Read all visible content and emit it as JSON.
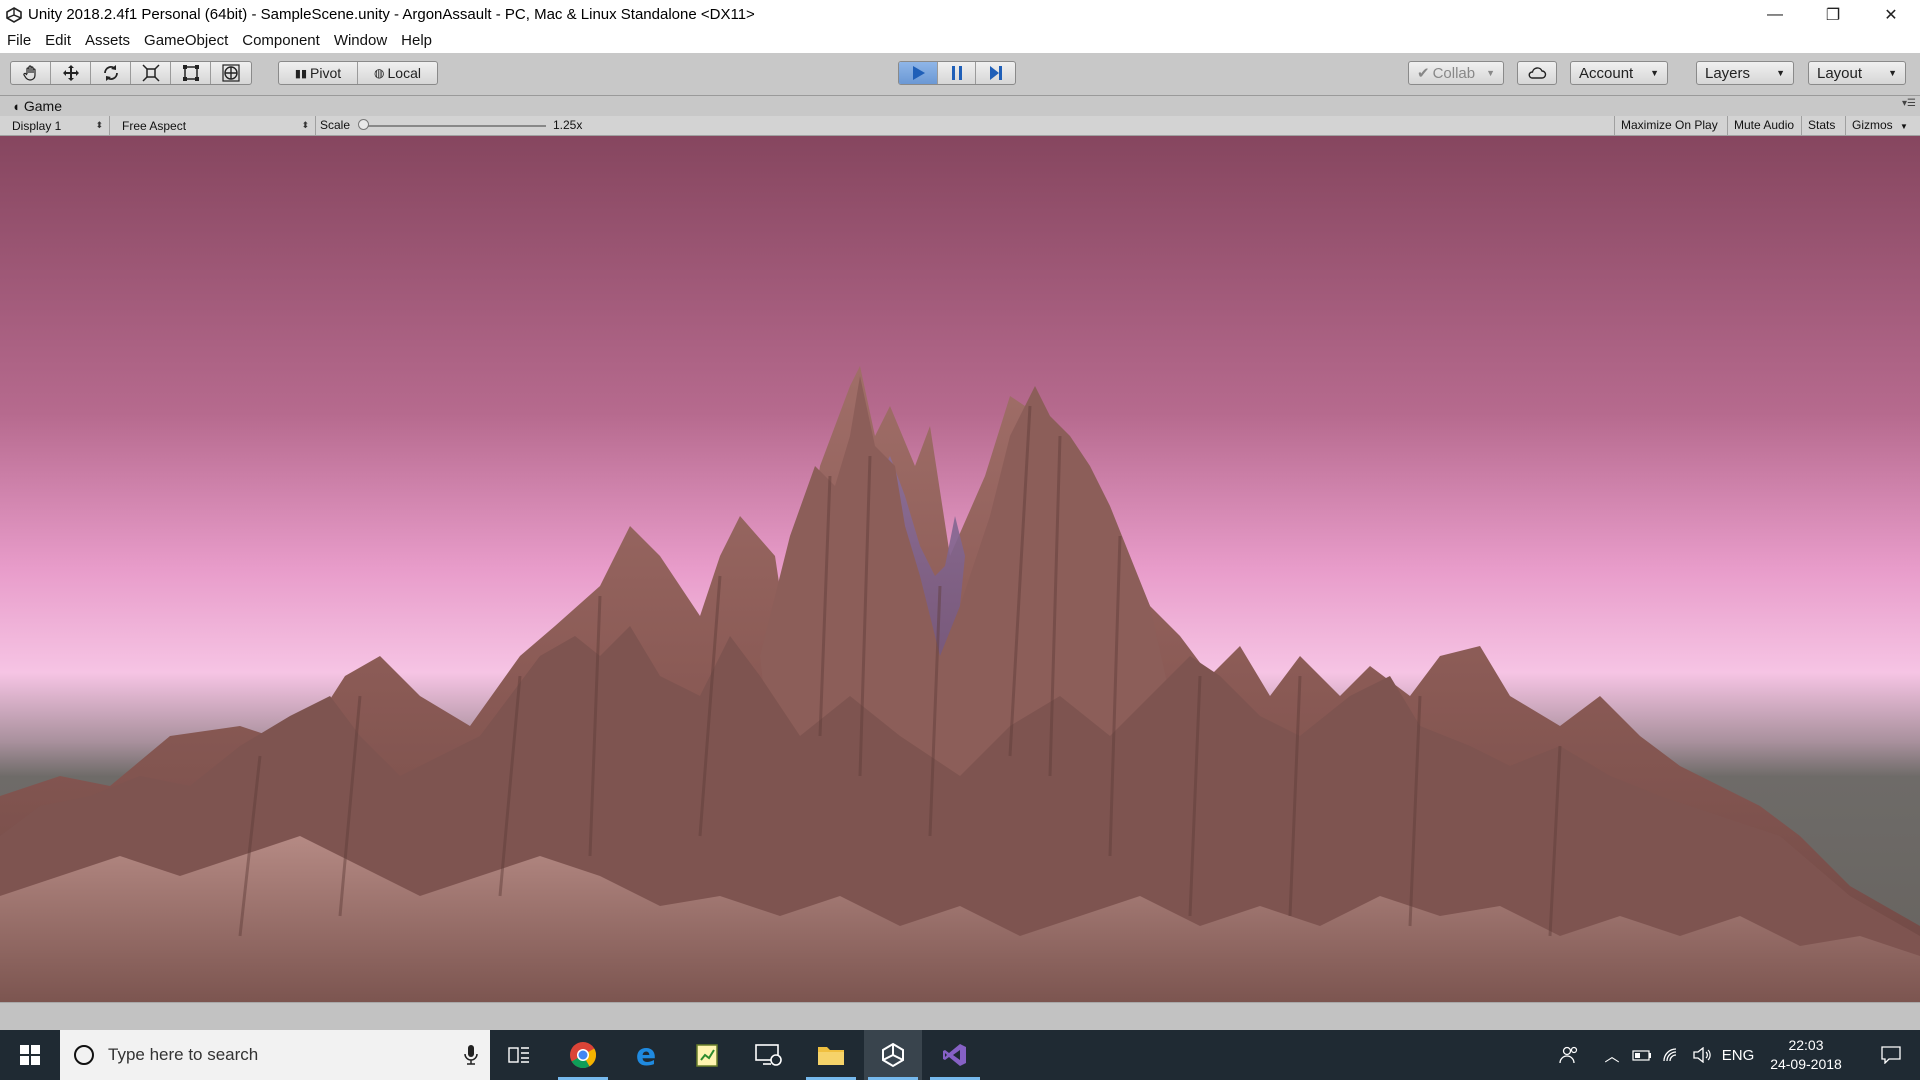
{
  "window": {
    "title": "Unity 2018.2.4f1 Personal (64bit) - SampleScene.unity - ArgonAssault - PC, Mac & Linux Standalone <DX11>",
    "minimize": "—",
    "maximize": "❐",
    "close": "✕"
  },
  "menu": {
    "items": [
      "File",
      "Edit",
      "Assets",
      "GameObject",
      "Component",
      "Window",
      "Help"
    ]
  },
  "toolbar": {
    "pivot": "Pivot",
    "local": "Local",
    "collab": "Collab",
    "account": "Account",
    "layers": "Layers",
    "layout": "Layout",
    "play_active": true
  },
  "game_tab": {
    "label": "Game"
  },
  "game_toolbar": {
    "display": "Display 1",
    "aspect": "Free Aspect",
    "scale_label": "Scale",
    "scale_value": "1.25x",
    "maximize_on_play": "Maximize On Play",
    "mute_audio": "Mute Audio",
    "stats": "Stats",
    "gizmos": "Gizmos"
  },
  "scene": {
    "sky_top": "#8a4a64",
    "sky_horizon": "#f3b3de",
    "ground": "#6c6a66",
    "terrain": "#8e5e58"
  },
  "taskbar": {
    "search_placeholder": "Type here to search",
    "language": "ENG",
    "time": "22:03",
    "date": "24-09-2018"
  }
}
